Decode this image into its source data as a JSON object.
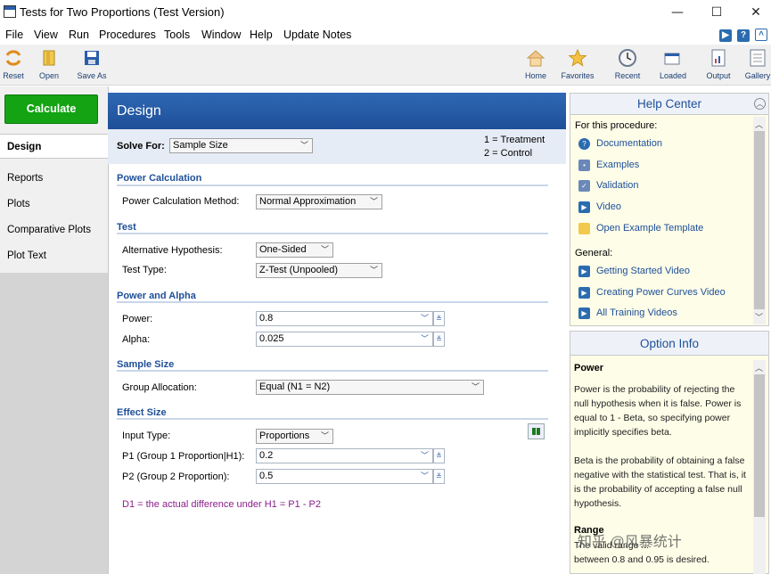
{
  "window": {
    "title": "Tests for Two Proportions (Test Version)",
    "min": "—",
    "max": "☐",
    "close": "✕"
  },
  "menu": [
    "File",
    "View",
    "Run",
    "Procedures",
    "Tools",
    "Window",
    "Help",
    "Update Notes"
  ],
  "toolbar": {
    "left": [
      "Reset",
      "Open",
      "Save As"
    ],
    "right": [
      "Home",
      "Favorites",
      "Recent",
      "Loaded",
      "Output",
      "Gallery"
    ]
  },
  "leftnav": {
    "calculate": "Calculate",
    "items": [
      "Design",
      "Reports",
      "Plots",
      "Comparative Plots",
      "Plot Text"
    ]
  },
  "design": {
    "header": "Design",
    "solve_label": "Solve For:",
    "solve_value": "Sample Size",
    "legend1": "1 = Treatment",
    "legend2": "2 = Control",
    "sections": {
      "power_calc": "Power Calculation",
      "test": "Test",
      "power_alpha": "Power and Alpha",
      "sample_size": "Sample Size",
      "effect_size": "Effect Size"
    },
    "fields": {
      "pcm_label": "Power Calculation Method:",
      "pcm_value": "Normal Approximation",
      "alt_label": "Alternative Hypothesis:",
      "alt_value": "One-Sided",
      "tt_label": "Test Type:",
      "tt_value": "Z-Test (Unpooled)",
      "power_label": "Power:",
      "power_value": "0.8",
      "alpha_label": "Alpha:",
      "alpha_value": "0.025",
      "ga_label": "Group Allocation:",
      "ga_value": "Equal (N1 = N2)",
      "it_label": "Input Type:",
      "it_value": "Proportions",
      "p1_label": "P1 (Group 1 Proportion|H1):",
      "p1_value": "0.2",
      "p2_label": "P2 (Group 2 Proportion):",
      "p2_value": "0.5"
    },
    "note": "D1 = the actual difference under H1 = P1 - P2"
  },
  "help": {
    "header": "Help Center",
    "for_label": "For this procedure:",
    "links": [
      "Documentation",
      "Examples",
      "Validation",
      "Video",
      "Open Example Template"
    ],
    "general_label": "General:",
    "general": [
      "Getting Started Video",
      "Creating Power Curves Video",
      "All Training Videos"
    ]
  },
  "option": {
    "header": "Option Info",
    "title": "Power",
    "p1": "Power is the probability of rejecting the null hypothesis when it is false. Power is equal to 1 - Beta, so specifying power implicitly specifies beta.",
    "p2": "Beta is the probability of obtaining a false negative with the statistical test. That is, it is the probability of accepting a false null hypothesis.",
    "range_title": "Range",
    "range_text": "The valid range ...",
    "range_text2": "between 0.8 and 0.95 is desired."
  },
  "watermark": "知乎 @风暴统计"
}
